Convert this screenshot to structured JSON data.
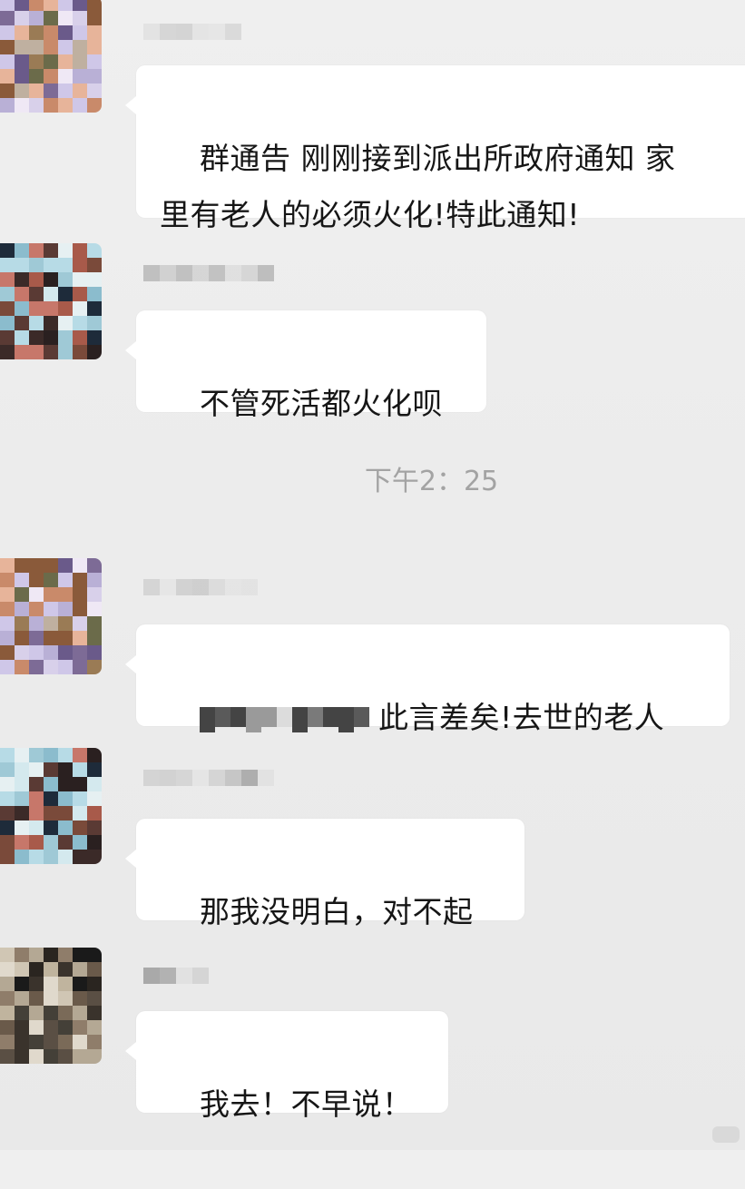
{
  "messages": [
    {
      "id": "m1",
      "sender_name": "",
      "text": "群通告 刚刚接到派出所政府通知 家\n里有老人的必须火化!特此通知!"
    },
    {
      "id": "m2",
      "sender_name": "",
      "text": "不管死活都火化呗"
    },
    {
      "id": "m3",
      "sender_name": "",
      "text_after_redaction": "此言差矣!去世的老人"
    },
    {
      "id": "m4",
      "sender_name": "",
      "text": "那我没明白，对不起"
    },
    {
      "id": "m5",
      "sender_name": "",
      "text": "我去！不早说！"
    }
  ],
  "timestamp": "下午2：25",
  "colors": {
    "background": "#ececec",
    "bubble": "#ffffff",
    "timestamp_text": "#a3a3a3"
  },
  "icons": {
    "avatar": "pixelated-avatar",
    "name": "pixelated-name-redaction"
  }
}
